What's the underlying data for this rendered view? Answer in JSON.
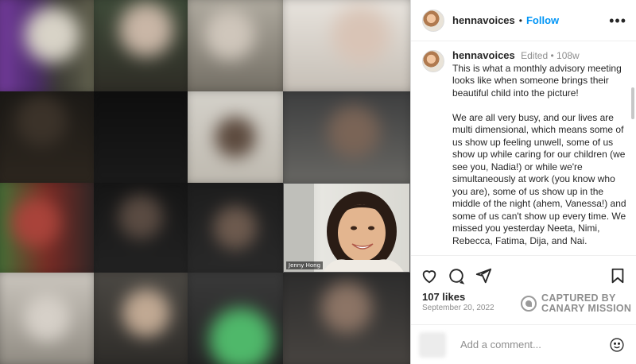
{
  "post": {
    "username": "hennavoices",
    "follow_label": "Follow",
    "separator": "•",
    "more_label": "•••"
  },
  "caption": {
    "username": "hennavoices",
    "edited_label": "Edited",
    "separator": "•",
    "age": "108w",
    "text": "This is what a monthly advisory meeting looks like when someone brings their beautiful child into the picture!\n\nWe are all very busy, and our lives are multi dimensional, which means some of us show up feeling unwell, some of us show up while caring for our children (we see you, Nadia!) or while we're simultaneously at work (you know who you are), some of us show up in the middle of the night (ahem, Vanessa!) and some of us can't show up every time. We missed you yesterday Neeta, Nimi, Rebecca, Fatima, Dija, and Nai."
  },
  "media": {
    "participant_label": "Jenny Hong"
  },
  "actions": {
    "icons": [
      "heart-icon",
      "comment-icon",
      "share-icon",
      "bookmark-icon"
    ]
  },
  "likes": "107 likes",
  "date": "September 20, 2022",
  "watermark": {
    "line1": "CAPTURED BY",
    "line2": "CANARY MISSION"
  },
  "comment": {
    "placeholder": "Add a comment..."
  },
  "colors": {
    "follow": "#0095f6",
    "muted": "#8e8e8e",
    "text": "#262626"
  }
}
